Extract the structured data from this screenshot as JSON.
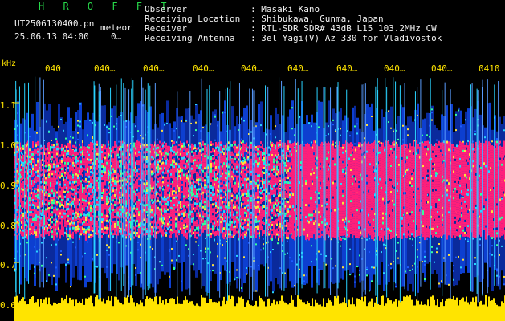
{
  "brand": "H R O F F T",
  "file_name": "UT2506130400.pn",
  "file_tag": "meteor",
  "datetime": "25.06.13 04:00",
  "counter": "0…",
  "fields": [
    {
      "label": "Observer",
      "value": ": Masaki Kano"
    },
    {
      "label": "Receiving Location",
      "value": ": Shibukawa, Gunma, Japan"
    },
    {
      "label": "Receiver",
      "value": ": RTL-SDR SDR# 43dB L15 103.2MHz CW"
    },
    {
      "label": "Receiving Antenna",
      "value": ": 3el Yagi(V) Az 330 for Vladivostok"
    }
  ],
  "y_unit": "kHz",
  "y_ticks": [
    "1.1",
    "1.0",
    "0.9",
    "0.8",
    "0.7",
    "0.6"
  ],
  "x_ticks": [
    "040",
    "040…",
    "040…",
    "040…",
    "040…",
    "040…",
    "040…",
    "040…",
    "040…",
    "0410"
  ],
  "colors": {
    "label_yellow": "#ffe400",
    "brand_green": "#27d94a",
    "signal_pink": "#ff1f7a",
    "noise_blue": "#1e5cff"
  }
}
